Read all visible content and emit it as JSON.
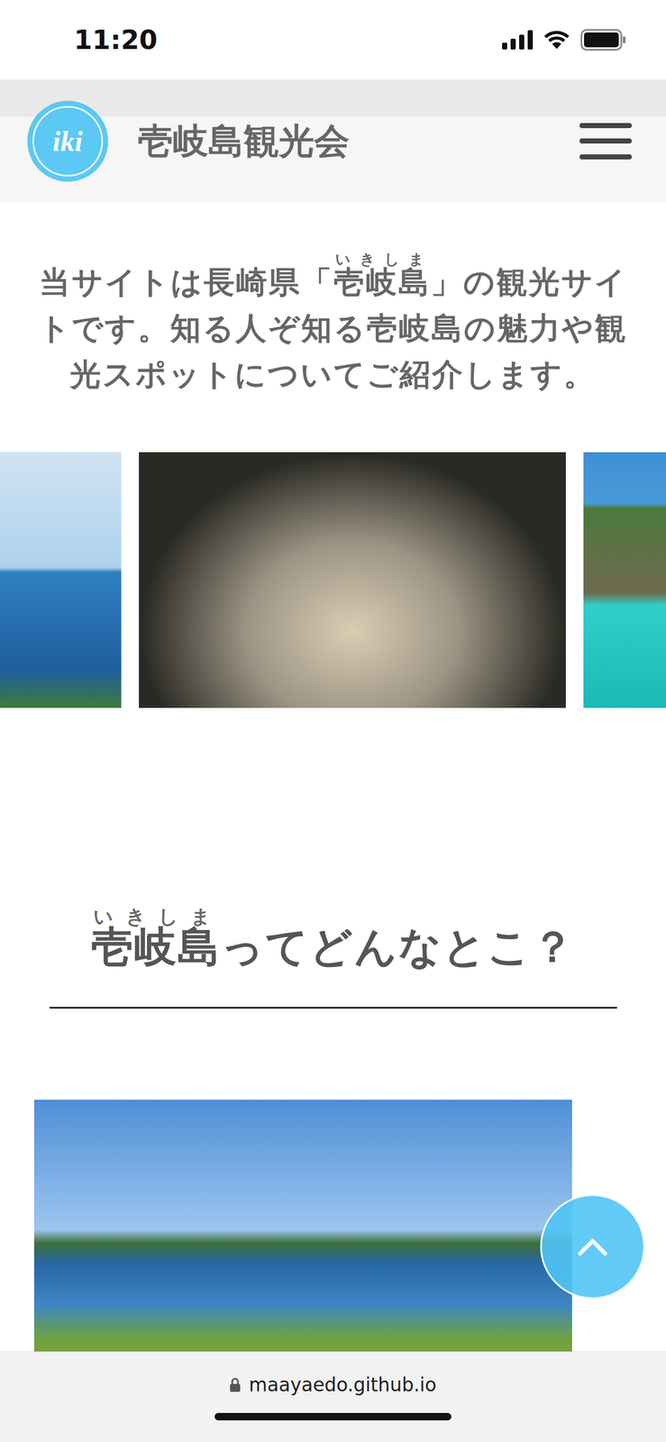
{
  "statusBar": {
    "time": "11:20"
  },
  "header": {
    "logoText": "iki",
    "title": "壱岐島観光会"
  },
  "intro": {
    "before": "当サイトは長崎県「",
    "rubyBase": "壱岐島",
    "rubyText": "いきしま",
    "after": "」の観光サイトです。知る人ぞ知る壱岐島の魅力や観光スポットについてご紹介します。"
  },
  "carousel": {
    "slides": [
      {
        "selected": false
      },
      {
        "selected": true
      },
      {
        "selected": false
      }
    ]
  },
  "section": {
    "rubyBase": "壱岐島",
    "rubyText": "いきしま",
    "after": "ってどんなとこ？"
  },
  "browser": {
    "url": "maayaedo.github.io"
  }
}
